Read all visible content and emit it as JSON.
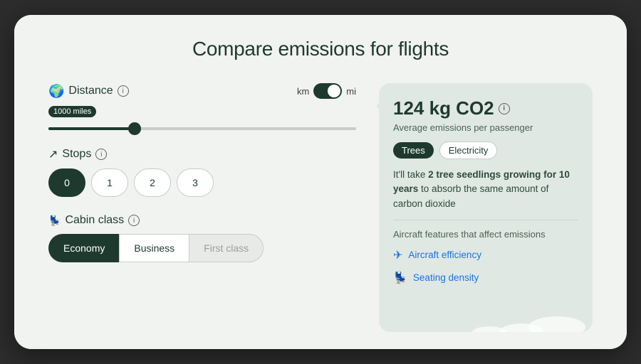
{
  "title": "Compare emissions for flights",
  "left": {
    "distance": {
      "label": "Distance",
      "km_label": "km",
      "mi_label": "mi",
      "slider_value": "1000 miles",
      "slider_percent": 28
    },
    "stops": {
      "label": "Stops",
      "options": [
        "0",
        "1",
        "2",
        "3"
      ],
      "active_index": 0
    },
    "cabin": {
      "label": "Cabin class",
      "options": [
        "Economy",
        "Business",
        "First class"
      ],
      "active_index": 0
    }
  },
  "right": {
    "co2_value": "124 kg CO2",
    "co2_subtitle": "Average emissions per passenger",
    "tags": [
      {
        "label": "Trees",
        "active": true
      },
      {
        "label": "Electricity",
        "active": false
      }
    ],
    "comparison_text_pre": "It'll take ",
    "comparison_bold": "2 tree seedlings growing for 10 years",
    "comparison_text_post": " to absorb the same amount of carbon dioxide",
    "features_title": "Aircraft features that affect emissions",
    "features": [
      {
        "label": "Aircraft efficiency",
        "icon": "✈"
      },
      {
        "label": "Seating density",
        "icon": "💺"
      }
    ]
  }
}
